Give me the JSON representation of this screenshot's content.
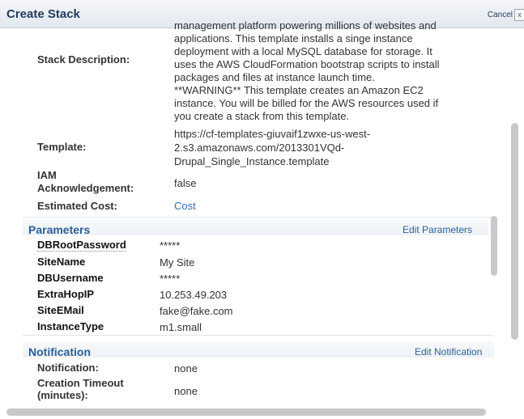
{
  "window": {
    "title": "Create Stack",
    "cancel_label": "Cancel",
    "close_glyph": "x"
  },
  "review": {
    "description_label": "Stack Description:",
    "description_lines": [
      "management platform powering millions of websites and",
      "applications. This template installs a singe instance",
      "deployment with a local MySQL database for storage. It",
      "uses the AWS CloudFormation bootstrap scripts to install",
      "packages and files at instance launch time.",
      "**WARNING** This template creates an Amazon EC2",
      "instance. You will be billed for the AWS resources used if",
      "you create a stack from this template."
    ],
    "template_label": "Template:",
    "template_lines": [
      "https://cf-templates-giuvaif1zwxe-us-west-",
      "2.s3.amazonaws.com/2013301VQd-",
      "Drupal_Single_Instance.template"
    ],
    "iam_label_line1": "IAM",
    "iam_label_line2": "Acknowledgement:",
    "iam_value": "false",
    "cost_label": "Estimated Cost:",
    "cost_link": "Cost"
  },
  "parameters": {
    "header": "Parameters",
    "edit_label": "Edit Parameters",
    "rows": [
      {
        "name": "DBRootPassword",
        "value": "*****"
      },
      {
        "name": "SiteName",
        "value": "My Site"
      },
      {
        "name": "DBUsername",
        "value": "*****"
      },
      {
        "name": "ExtraHopIP",
        "value": "10.253.49.203"
      },
      {
        "name": "SiteEMail",
        "value": "fake@fake.com"
      },
      {
        "name": "InstanceType",
        "value": "m1.small"
      }
    ]
  },
  "notification": {
    "header": "Notification",
    "edit_label": "Edit Notification",
    "notification_label": "Notification:",
    "notification_value": "none",
    "timeout_label_line1": "Creation Timeout",
    "timeout_label_line2": "(minutes):",
    "timeout_value": "none"
  }
}
